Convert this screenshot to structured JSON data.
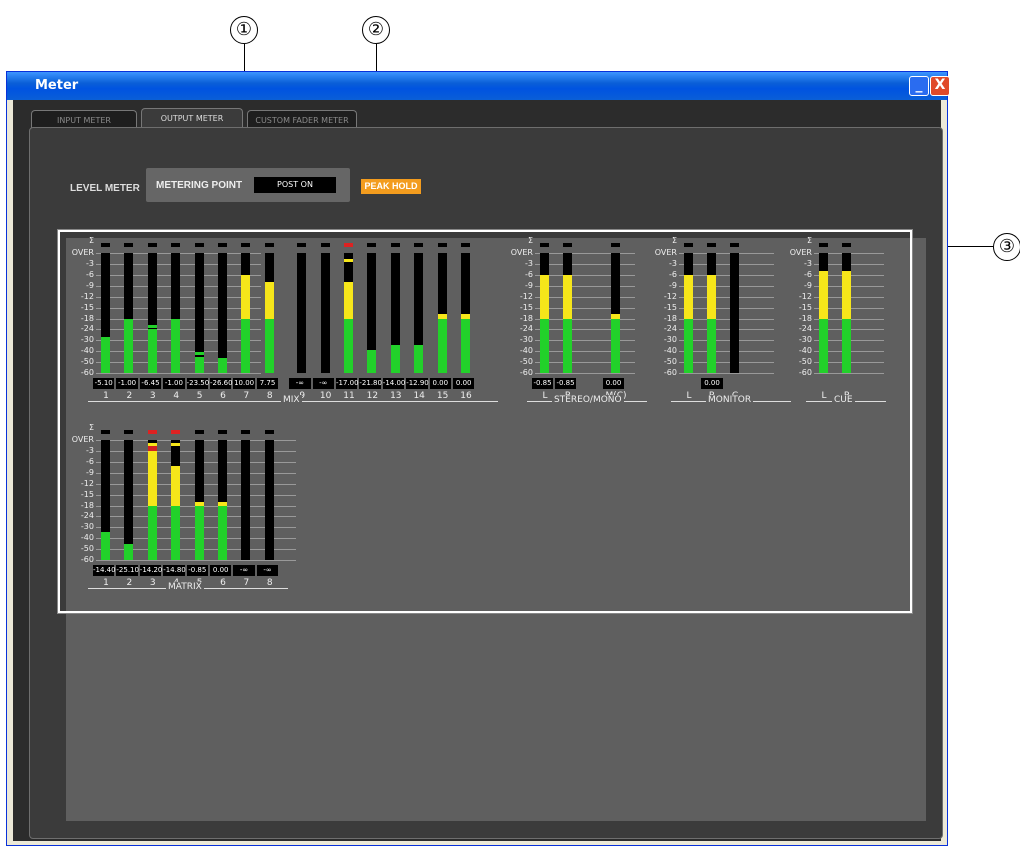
{
  "callouts": [
    "①",
    "②",
    "③"
  ],
  "window": {
    "title": "Meter",
    "minimize": "_",
    "close": "X"
  },
  "tabs": [
    "INPUT METER",
    "OUTPUT METER",
    "CUSTOM FADER METER"
  ],
  "level_meter_label": "LEVEL METER",
  "metering_point": {
    "label": "METERING POINT",
    "value": "POST ON"
  },
  "peak_hold": "PEAK HOLD",
  "scale": [
    "Σ",
    "OVER",
    "-3",
    "-6",
    "-9",
    "-12",
    "-15",
    "-18",
    "-24",
    "-30",
    "-40",
    "-50",
    "-60"
  ],
  "colors": {
    "green": "#22d12a",
    "yellow": "#f6e61a",
    "red": "#d22222",
    "peak_hold": "#f39c1e"
  },
  "groups": {
    "mix": {
      "label": "MIX",
      "channels": [
        {
          "name": "1",
          "value": "-5.10",
          "level_db": -28,
          "peak_db": null,
          "over": false
        },
        {
          "name": "2",
          "value": "-1.00",
          "level_db": -18,
          "peak_db": null,
          "over": false
        },
        {
          "name": "3",
          "value": "-6.45",
          "level_db": -24,
          "peak_db": -22,
          "over": false
        },
        {
          "name": "4",
          "value": "-1.00",
          "level_db": -18,
          "peak_db": null,
          "over": false
        },
        {
          "name": "5",
          "value": "-23.50",
          "level_db": -45,
          "peak_db": -42,
          "over": false
        },
        {
          "name": "6",
          "value": "-26.60",
          "level_db": -46,
          "peak_db": null,
          "over": false
        },
        {
          "name": "7",
          "value": "10.00",
          "level_db": -6,
          "peak_db": null,
          "over": false
        },
        {
          "name": "8",
          "value": "7.75",
          "level_db": -8,
          "peak_db": null,
          "over": false
        },
        {
          "name": "9",
          "value": "-∞",
          "level_db": -61,
          "peak_db": null,
          "over": false
        },
        {
          "name": "10",
          "value": "-∞",
          "level_db": -61,
          "peak_db": null,
          "over": false
        },
        {
          "name": "11",
          "value": "-17.00",
          "level_db": -8,
          "peak_db": -2,
          "over": true
        },
        {
          "name": "12",
          "value": "-21.80",
          "level_db": -42,
          "peak_db": -40,
          "over": false
        },
        {
          "name": "13",
          "value": "-14.00",
          "level_db": -34,
          "peak_db": null,
          "over": false
        },
        {
          "name": "14",
          "value": "-12.90",
          "level_db": -34,
          "peak_db": null,
          "over": false
        },
        {
          "name": "15",
          "value": "0.00",
          "level_db": -17,
          "peak_db": -17,
          "over": false
        },
        {
          "name": "16",
          "value": "0.00",
          "level_db": -17,
          "peak_db": -17,
          "over": false
        }
      ]
    },
    "stereo_mono": {
      "label": "STEREO/MONO",
      "channels": [
        {
          "name": "L",
          "value": "-0.85",
          "level_db": -6,
          "peak_db": null,
          "over": false
        },
        {
          "name": "R",
          "value": "-0.85",
          "level_db": -6,
          "peak_db": null,
          "over": false
        },
        {
          "name": "M(C)",
          "value": "0.00",
          "level_db": -17,
          "peak_db": -17,
          "over": false
        }
      ]
    },
    "monitor": {
      "label": "MONITOR",
      "value": "0.00",
      "channels": [
        {
          "name": "L",
          "level_db": -6,
          "peak_db": null,
          "over": false
        },
        {
          "name": "R",
          "level_db": -6,
          "peak_db": null,
          "over": false
        },
        {
          "name": "C",
          "level_db": -61,
          "peak_db": null,
          "over": false
        }
      ]
    },
    "cue": {
      "label": "CUE",
      "channels": [
        {
          "name": "L",
          "level_db": -5,
          "peak_db": null,
          "over": false
        },
        {
          "name": "R",
          "level_db": -5,
          "peak_db": null,
          "over": false
        }
      ]
    },
    "matrix": {
      "label": "MATRIX",
      "channels": [
        {
          "name": "1",
          "value": "-14.40",
          "level_db": -34,
          "peak_db": null,
          "over": false
        },
        {
          "name": "2",
          "value": "-25.10",
          "level_db": -45,
          "peak_db": null,
          "over": false
        },
        {
          "name": "3",
          "value": "-14.20",
          "level_db": -1,
          "peak_db": -1,
          "over": true
        },
        {
          "name": "4",
          "value": "-14.80",
          "level_db": -7,
          "peak_db": -1,
          "over": true
        },
        {
          "name": "5",
          "value": "-0.85",
          "level_db": -17,
          "peak_db": null,
          "over": false
        },
        {
          "name": "6",
          "value": "0.00",
          "level_db": -17,
          "peak_db": null,
          "over": false
        },
        {
          "name": "7",
          "value": "-∞",
          "level_db": -61,
          "peak_db": null,
          "over": false
        },
        {
          "name": "8",
          "value": "-∞",
          "level_db": -61,
          "peak_db": null,
          "over": false
        }
      ]
    }
  }
}
